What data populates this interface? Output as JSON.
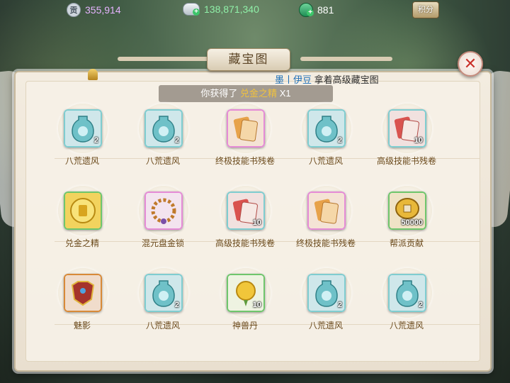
{
  "currency": {
    "contribution": "355,914",
    "contribution_icon_text": "贡",
    "silver": "138,871,340",
    "jade": "881",
    "points_label": "积分"
  },
  "dialog": {
    "title": "藏宝图",
    "close_symbol": "✕"
  },
  "notice": {
    "player": "墨丨伊豆",
    "message": "拿着高级藏宝图"
  },
  "toast": {
    "prefix": "你获得了",
    "item": "兑金之精",
    "count": "X1"
  },
  "items": [
    {
      "label": "八荒遗风",
      "qty": "2",
      "icon": "vase-icon",
      "frame": "blue"
    },
    {
      "label": "八荒遗风",
      "qty": "2",
      "icon": "vase-icon",
      "frame": "blue"
    },
    {
      "label": "终极技能书残卷",
      "qty": "",
      "icon": "scroll-gold-icon",
      "frame": "rare"
    },
    {
      "label": "八荒遗风",
      "qty": "2",
      "icon": "vase-icon",
      "frame": "blue"
    },
    {
      "label": "高级技能书残卷",
      "qty": "10",
      "icon": "scroll-red-icon",
      "frame": "blue"
    },
    {
      "label": "兑金之精",
      "qty": "",
      "icon": "gold-essence-icon",
      "frame": "gold"
    },
    {
      "label": "混元盘金锁",
      "qty": "",
      "icon": "bead-necklace-icon",
      "frame": "rare"
    },
    {
      "label": "高级技能书残卷",
      "qty": "10",
      "icon": "scroll-red-icon",
      "frame": "blue"
    },
    {
      "label": "终极技能书残卷",
      "qty": "",
      "icon": "scroll-gold-icon",
      "frame": "rare"
    },
    {
      "label": "帮派贡献",
      "qty": "50000",
      "icon": "coin-icon",
      "frame": "gold"
    },
    {
      "label": "魅影",
      "qty": "",
      "icon": "armor-icon",
      "frame": "orange"
    },
    {
      "label": "八荒遗风",
      "qty": "2",
      "icon": "vase-icon",
      "frame": "blue"
    },
    {
      "label": "神兽丹",
      "qty": "10",
      "icon": "beast-pill-icon",
      "frame": "gold"
    },
    {
      "label": "八荒遗风",
      "qty": "2",
      "icon": "vase-icon",
      "frame": "blue"
    },
    {
      "label": "八荒遗风",
      "qty": "2",
      "icon": "vase-icon",
      "frame": "blue"
    }
  ],
  "colors": {
    "label_text": "#6b4a1c",
    "frame_blue": "#7fcdd0",
    "frame_rare": "#e58bd6",
    "close_red": "#c9312a"
  }
}
